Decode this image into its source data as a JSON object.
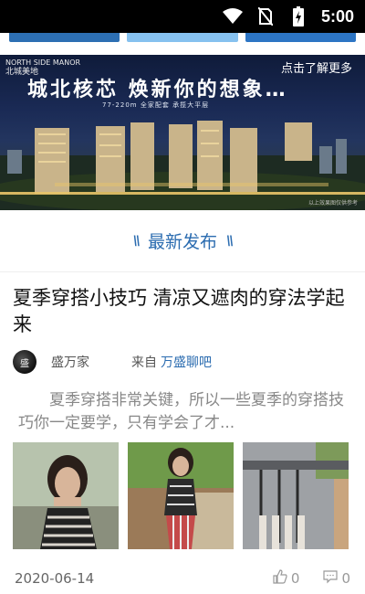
{
  "status_bar": {
    "time": "5:00"
  },
  "banner": {
    "brand_en": "NORTH SIDE MANOR",
    "brand_cn": "北城美地",
    "cta": "点击了解更多",
    "headline": "城北核芯  焕新你的想象…",
    "sub": "77-220m  全家配套  承揽大平层",
    "corner": "以上效果图仅供参考"
  },
  "section": {
    "title": "最新发布"
  },
  "article": {
    "title": "夏季穿搭小技巧 清凉又遮肉的穿法学起来",
    "author": "盛万家",
    "from_label": "来自",
    "source": "万盛聊吧",
    "summary": "夏季穿搭非常关键，所以一些夏季的穿搭技巧你一定要学，只有学会了才...",
    "date": "2020-06-14",
    "likes": "0",
    "comments": "0"
  },
  "colors": {
    "accent": "#2b6cb0",
    "status_bar": "#000000"
  },
  "icons": [
    "wifi-icon",
    "no-sim-icon",
    "battery-icon",
    "like-icon",
    "comment-icon"
  ]
}
